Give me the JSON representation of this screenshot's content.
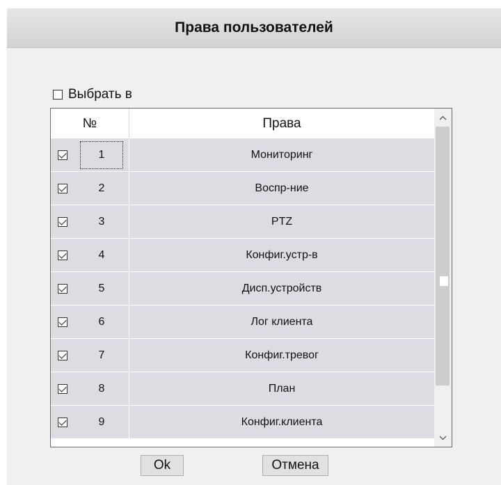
{
  "dialog": {
    "title": "Права пользователей",
    "select_all_label": "Выбрать в",
    "select_all_checked": false
  },
  "table": {
    "columns": {
      "num": "№",
      "rights": "Права"
    },
    "rows": [
      {
        "num": "1",
        "right": "Мониторинг",
        "checked": true
      },
      {
        "num": "2",
        "right": "Воспр-ние",
        "checked": true
      },
      {
        "num": "3",
        "right": "PTZ",
        "checked": true
      },
      {
        "num": "4",
        "right": "Конфиг.устр-в",
        "checked": true
      },
      {
        "num": "5",
        "right": "Дисп.устройств",
        "checked": true
      },
      {
        "num": "6",
        "right": "Лог клиента",
        "checked": true
      },
      {
        "num": "7",
        "right": "Конфиг.тревог",
        "checked": true
      },
      {
        "num": "8",
        "right": "План",
        "checked": true
      },
      {
        "num": "9",
        "right": "Конфиг.клиента",
        "checked": true
      }
    ]
  },
  "buttons": {
    "ok": "Ok",
    "cancel": "Отмена"
  },
  "icons": {
    "scroll_up": "chevron-up-icon",
    "scroll_down": "chevron-down-icon",
    "checkbox": "checkbox-icon"
  }
}
